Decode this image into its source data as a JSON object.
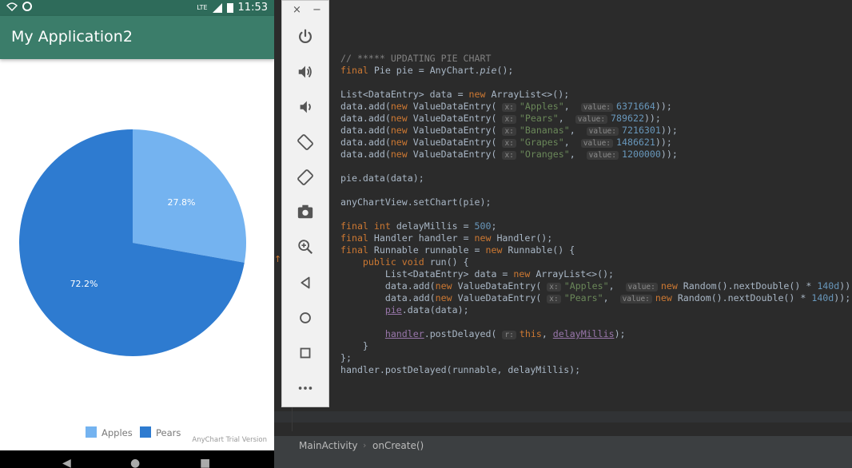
{
  "phone": {
    "status": {
      "time": "11:53",
      "network": "LTE"
    },
    "app_title": "My Application2",
    "chart_watermark": "AnyChart Trial Version"
  },
  "chart_data": {
    "type": "pie",
    "categories": [
      "Apples",
      "Pears"
    ],
    "values": [
      27.8,
      72.2
    ],
    "labels": [
      "27.8%",
      "72.2%"
    ],
    "colors": [
      "#74b3f0",
      "#2e7bd0"
    ],
    "legend_position": "bottom"
  },
  "emulator_toolbar": {
    "close": "×",
    "minimize": "−",
    "tools": [
      "power-icon",
      "volume-up-icon",
      "volume-down-icon",
      "rotate-left-icon",
      "rotate-right-icon",
      "camera-icon",
      "zoom-icon",
      "back-icon",
      "home-icon",
      "overview-icon",
      "more-icon"
    ]
  },
  "code_lines": [
    [
      {
        "t": "// ***** UPDATING PIE CHART",
        "c": "cm"
      }
    ],
    [
      {
        "t": "final ",
        "c": "kw"
      },
      {
        "t": "Pie pie = AnyChart."
      },
      {
        "t": "pie",
        "c": "it"
      },
      {
        "t": "();"
      }
    ],
    [],
    [
      {
        "t": "List<DataEntry> data = "
      },
      {
        "t": "new ",
        "c": "kw"
      },
      {
        "t": "ArrayList<>();"
      }
    ],
    [
      {
        "t": "data.add("
      },
      {
        "t": "new ",
        "c": "kw"
      },
      {
        "t": "ValueDataEntry( "
      },
      {
        "t": "x:",
        "c": "hint"
      },
      {
        "t": "\"Apples\"",
        "c": "str"
      },
      {
        "t": ",  "
      },
      {
        "t": "value:",
        "c": "hint"
      },
      {
        "t": "6371664",
        "c": "num"
      },
      {
        "t": "));"
      }
    ],
    [
      {
        "t": "data.add("
      },
      {
        "t": "new ",
        "c": "kw"
      },
      {
        "t": "ValueDataEntry( "
      },
      {
        "t": "x:",
        "c": "hint"
      },
      {
        "t": "\"Pears\"",
        "c": "str"
      },
      {
        "t": ",  "
      },
      {
        "t": "value:",
        "c": "hint"
      },
      {
        "t": "789622",
        "c": "num"
      },
      {
        "t": "));"
      }
    ],
    [
      {
        "t": "data.add("
      },
      {
        "t": "new ",
        "c": "kw"
      },
      {
        "t": "ValueDataEntry( "
      },
      {
        "t": "x:",
        "c": "hint"
      },
      {
        "t": "\"Bananas\"",
        "c": "str"
      },
      {
        "t": ",  "
      },
      {
        "t": "value:",
        "c": "hint"
      },
      {
        "t": "7216301",
        "c": "num"
      },
      {
        "t": "));"
      }
    ],
    [
      {
        "t": "data.add("
      },
      {
        "t": "new ",
        "c": "kw"
      },
      {
        "t": "ValueDataEntry( "
      },
      {
        "t": "x:",
        "c": "hint"
      },
      {
        "t": "\"Grapes\"",
        "c": "str"
      },
      {
        "t": ",  "
      },
      {
        "t": "value:",
        "c": "hint"
      },
      {
        "t": "1486621",
        "c": "num"
      },
      {
        "t": "));"
      }
    ],
    [
      {
        "t": "data.add("
      },
      {
        "t": "new ",
        "c": "kw"
      },
      {
        "t": "ValueDataEntry( "
      },
      {
        "t": "x:",
        "c": "hint"
      },
      {
        "t": "\"Oranges\"",
        "c": "str"
      },
      {
        "t": ",  "
      },
      {
        "t": "value:",
        "c": "hint"
      },
      {
        "t": "1200000",
        "c": "num"
      },
      {
        "t": "));"
      }
    ],
    [],
    [
      {
        "t": "pie.data(data);"
      }
    ],
    [],
    [
      {
        "t": "anyChartView.setChart(pie);"
      }
    ],
    [],
    [
      {
        "t": "final int ",
        "c": "kw"
      },
      {
        "t": "delayMillis = "
      },
      {
        "t": "500",
        "c": "num"
      },
      {
        "t": ";"
      }
    ],
    [
      {
        "t": "final ",
        "c": "kw"
      },
      {
        "t": "Handler handler = "
      },
      {
        "t": "new ",
        "c": "kw"
      },
      {
        "t": "Handler();"
      }
    ],
    [
      {
        "t": "final ",
        "c": "kw"
      },
      {
        "t": "Runnable runnable = "
      },
      {
        "t": "new ",
        "c": "kw"
      },
      {
        "t": "Runnable() {"
      }
    ],
    [
      {
        "t": "    "
      },
      {
        "t": "public void ",
        "c": "kw"
      },
      {
        "t": "run() {"
      }
    ],
    [
      {
        "t": "        List<DataEntry> data = "
      },
      {
        "t": "new ",
        "c": "kw"
      },
      {
        "t": "ArrayList<>();"
      }
    ],
    [
      {
        "t": "        data.add("
      },
      {
        "t": "new ",
        "c": "kw"
      },
      {
        "t": "ValueDataEntry( "
      },
      {
        "t": "x:",
        "c": "hint"
      },
      {
        "t": "\"Apples\"",
        "c": "str"
      },
      {
        "t": ",  "
      },
      {
        "t": "value:",
        "c": "hint"
      },
      {
        "t": "new ",
        "c": "kw"
      },
      {
        "t": "Random().nextDouble() * "
      },
      {
        "t": "140d",
        "c": "num"
      },
      {
        "t": "));"
      }
    ],
    [
      {
        "t": "        data.add("
      },
      {
        "t": "new ",
        "c": "kw"
      },
      {
        "t": "ValueDataEntry( "
      },
      {
        "t": "x:",
        "c": "hint"
      },
      {
        "t": "\"Pears\"",
        "c": "str"
      },
      {
        "t": ",  "
      },
      {
        "t": "value:",
        "c": "hint"
      },
      {
        "t": "new ",
        "c": "kw"
      },
      {
        "t": "Random().nextDouble() * "
      },
      {
        "t": "140d",
        "c": "num"
      },
      {
        "t": "));"
      }
    ],
    [
      {
        "t": "        "
      },
      {
        "t": "pie",
        "c": "fld"
      },
      {
        "t": ".data(data);"
      }
    ],
    [],
    [
      {
        "t": "        "
      },
      {
        "t": "handler",
        "c": "fld"
      },
      {
        "t": ".postDelayed( "
      },
      {
        "t": "r:",
        "c": "hint"
      },
      {
        "t": "this",
        "c": "kw"
      },
      {
        "t": ", "
      },
      {
        "t": "delayMillis",
        "c": "fld"
      },
      {
        "t": ");"
      }
    ],
    [
      {
        "t": "    }"
      }
    ],
    [
      {
        "t": "};"
      }
    ],
    [
      {
        "t": "handler.postDelayed(runnable, delayMillis);"
      }
    ]
  ],
  "breadcrumb": {
    "class_name": "MainActivity",
    "separator": "›",
    "method": "onCreate()"
  }
}
